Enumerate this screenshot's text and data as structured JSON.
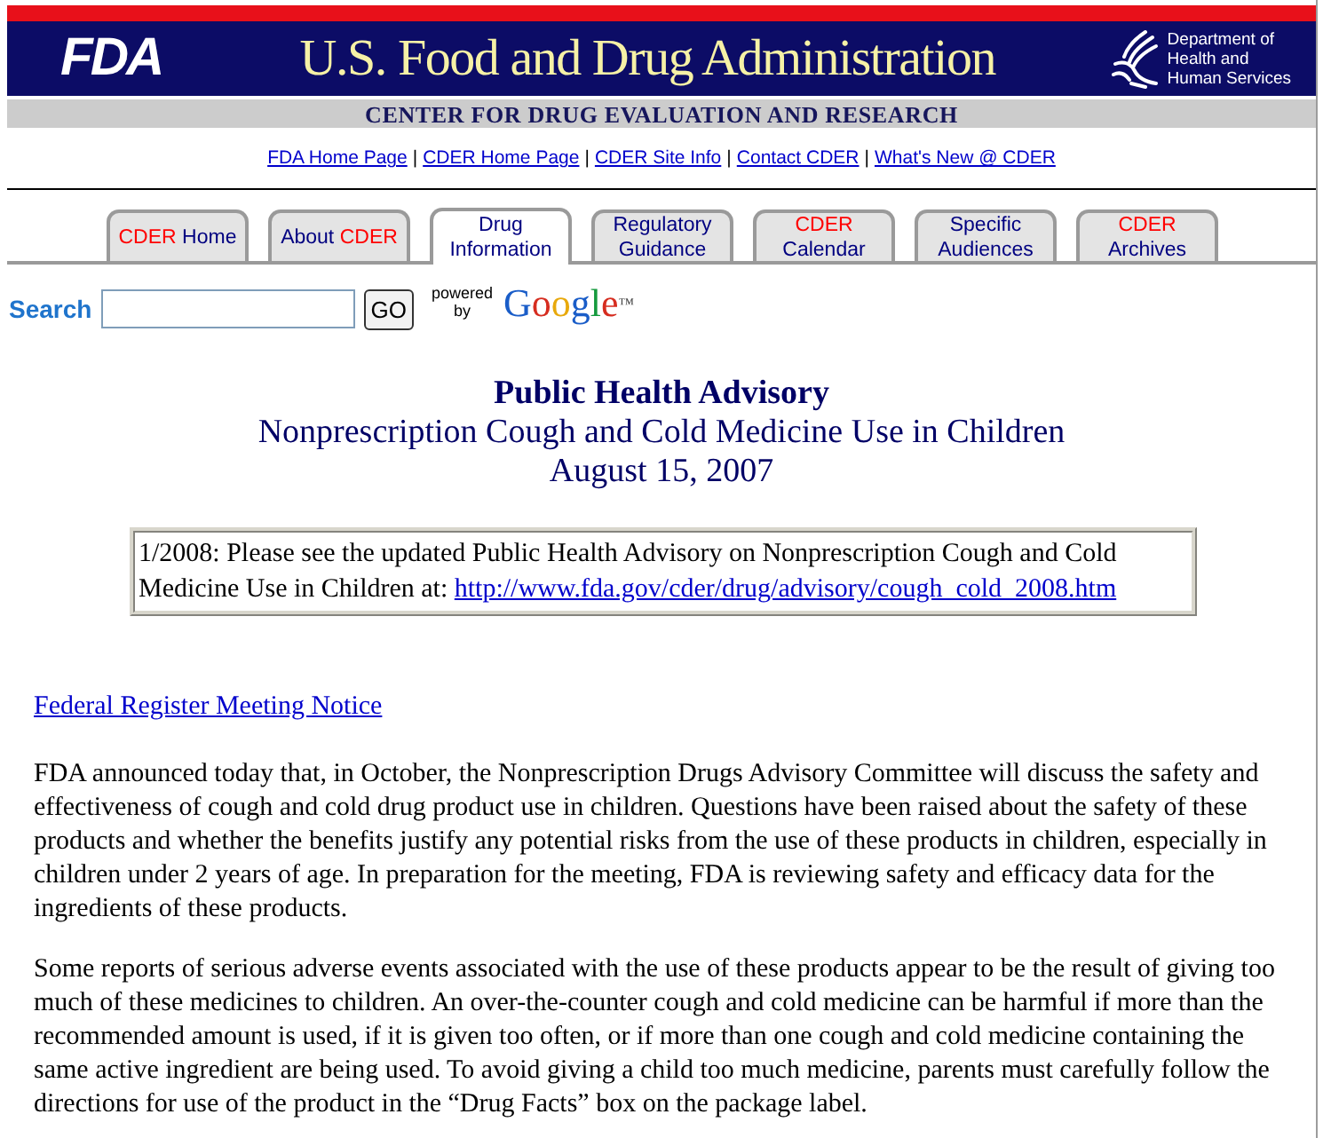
{
  "header": {
    "logo": "FDA",
    "title": "U.S. Food and Drug Administration",
    "department_lines": [
      "Department of",
      "Health and",
      "Human Services"
    ],
    "center_name": "CENTER FOR DRUG EVALUATION AND RESEARCH"
  },
  "top_links": {
    "items": [
      "FDA Home Page",
      "CDER Home Page",
      "CDER Site Info",
      "Contact CDER",
      "What's New @ CDER"
    ],
    "separator": "|"
  },
  "tabs": [
    {
      "lines": [
        [
          {
            "text": "CDER",
            "kind": "agency"
          },
          {
            "text": "Home",
            "kind": "topic"
          }
        ]
      ],
      "selected": false
    },
    {
      "lines": [
        [
          {
            "text": "About",
            "kind": "topic"
          },
          {
            "text": "CDER",
            "kind": "agency"
          }
        ]
      ],
      "selected": false
    },
    {
      "lines": [
        [
          {
            "text": "Drug",
            "kind": "topic"
          }
        ],
        [
          {
            "text": "Information",
            "kind": "topic"
          }
        ]
      ],
      "selected": true
    },
    {
      "lines": [
        [
          {
            "text": "Regulatory",
            "kind": "topic"
          }
        ],
        [
          {
            "text": "Guidance",
            "kind": "topic"
          }
        ]
      ],
      "selected": false
    },
    {
      "lines": [
        [
          {
            "text": "CDER",
            "kind": "agency"
          }
        ],
        [
          {
            "text": "Calendar",
            "kind": "topic"
          }
        ]
      ],
      "selected": false
    },
    {
      "lines": [
        [
          {
            "text": "Specific",
            "kind": "topic"
          }
        ],
        [
          {
            "text": "Audiences",
            "kind": "topic"
          }
        ]
      ],
      "selected": false
    },
    {
      "lines": [
        [
          {
            "text": "CDER",
            "kind": "agency"
          }
        ],
        [
          {
            "text": "Archives",
            "kind": "topic"
          }
        ]
      ],
      "selected": false
    }
  ],
  "search": {
    "label": "Search",
    "button": "GO",
    "powered_by_lines": [
      "powered",
      "by"
    ],
    "brand": "Google",
    "trademark": "™"
  },
  "advisory": {
    "title": "Public Health Advisory",
    "subtitle": "Nonprescription Cough and Cold Medicine Use in Children",
    "date": "August 15, 2007"
  },
  "update_notice": {
    "text": "1/2008: Please see the updated Public Health Advisory on Nonprescription Cough and Cold Medicine Use in Children at:",
    "link": "http://www.fda.gov/cder/drug/advisory/cough_cold_2008.htm"
  },
  "meeting_link": "Federal Register Meeting Notice",
  "paragraphs": [
    "FDA announced today that, in October, the Nonprescription Drugs Advisory Committee will discuss the safety and effectiveness of cough and cold drug product use in children. Questions have been raised about the safety of these products and whether the benefits justify any potential risks from the use of these products in children, especially in children under 2 years of age. In preparation for the meeting, FDA is reviewing safety and efficacy data for the ingredients of these products.",
    "Some reports of serious adverse events associated with the use of these products appear to be the result of giving too much of these medicines to children. An over-the-counter cough and cold medicine can be harmful if more than the recommended amount is used, if it is given too often, or if more than one cough and cold medicine containing the same active ingredient are being used. To avoid giving a child too much medicine, parents must carefully follow the directions for use of the product in the “Drug Facts” box on the package label."
  ]
}
